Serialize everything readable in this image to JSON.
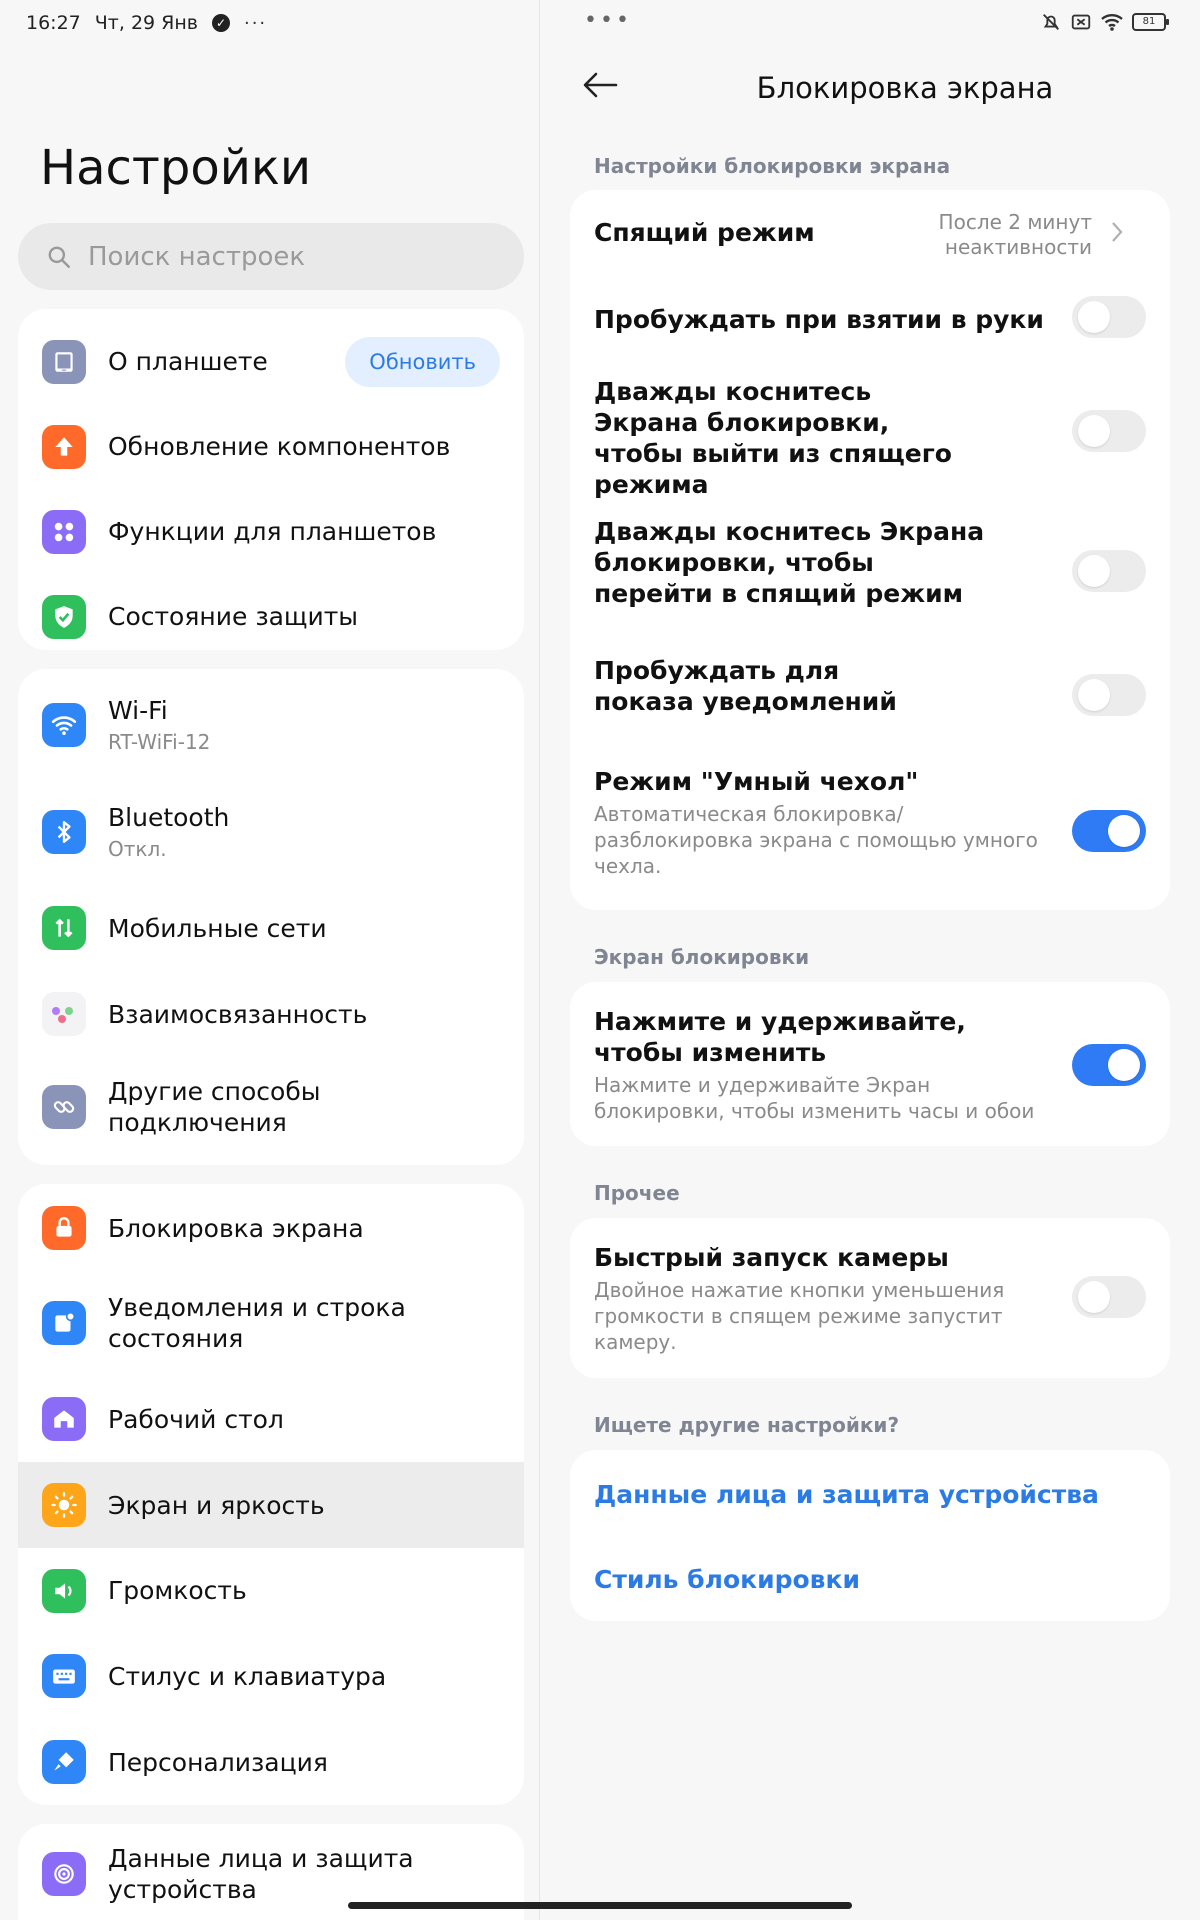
{
  "status_bar": {
    "time": "16:27",
    "date": "Чт, 29 Янв",
    "battery": "81"
  },
  "left": {
    "title": "Настройки",
    "search_placeholder": "Поиск настроек",
    "groups": [
      {
        "items": [
          {
            "label": "О планшете",
            "icon": "tablet-icon",
            "color": "#8a93b8",
            "badge": "Обновить"
          },
          {
            "label": "Обновление компонентов",
            "icon": "arrow-up-icon",
            "color": "#ff6a2a"
          },
          {
            "label": "Функции для планшетов",
            "icon": "grid-icon",
            "color": "#8b6cf6"
          },
          {
            "label": "Состояние защиты",
            "icon": "shield-check-icon",
            "color": "#2fbf5c"
          }
        ]
      },
      {
        "items": [
          {
            "label": "Wi-Fi",
            "sub": "RT-WiFi-12",
            "icon": "wifi-icon",
            "color": "#2f86f6"
          },
          {
            "label": "Bluetooth",
            "sub": "Откл.",
            "icon": "bluetooth-icon",
            "color": "#2f86f6"
          },
          {
            "label": "Мобильные сети",
            "icon": "mobile-data-icon",
            "color": "#2fbf5c"
          },
          {
            "label": "Взаимосвязанность",
            "icon": "interconnect-icon",
            "color": "#ffffff"
          },
          {
            "label": "Другие способы подключения",
            "icon": "link-icon",
            "color": "#8a93b8"
          }
        ]
      },
      {
        "items": [
          {
            "label": "Блокировка экрана",
            "icon": "lock-icon",
            "color": "#ff6a2a"
          },
          {
            "label": "Уведомления и строка состояния",
            "icon": "notification-icon",
            "color": "#2f86f6"
          },
          {
            "label": "Рабочий стол",
            "icon": "home-icon",
            "color": "#8b6cf6"
          },
          {
            "label": "Экран и яркость",
            "icon": "brightness-icon",
            "color": "#ffa51a",
            "active": true
          },
          {
            "label": "Громкость",
            "icon": "volume-icon",
            "color": "#2fbf5c"
          },
          {
            "label": "Стилус и клавиатура",
            "icon": "keyboard-icon",
            "color": "#2f86f6"
          },
          {
            "label": "Персонализация",
            "icon": "brush-icon",
            "color": "#2f86f6"
          }
        ]
      },
      {
        "items": [
          {
            "label": "Данные лица и защита устройства",
            "icon": "fingerprint-icon",
            "color": "#8b6cf6"
          }
        ]
      }
    ]
  },
  "right": {
    "title": "Блокировка экрана",
    "section1": "Настройки блокировки экрана",
    "sleep_title": "Спящий режим",
    "sleep_value": "После 2 минут неактивности",
    "sleep_value_line1": "После 2 минут",
    "sleep_value_line2": "неактивности",
    "toggles1": [
      {
        "title": "Пробуждать при взятии в руки",
        "on": false
      },
      {
        "title": "Дважды коснитесь Экрана блокировки, чтобы выйти из спящего режима",
        "on": false
      },
      {
        "title": "Дважды коснитесь Экрана блокировки, чтобы перейти в спящий режим",
        "on": false
      },
      {
        "title": "Пробуждать для показа уведомлений",
        "on": false
      },
      {
        "title": "Режим \"Умный чехол\"",
        "sub": "Автоматическая блокировка/ разблокировка экрана с помощью умного чехла.",
        "on": true
      }
    ],
    "section2": "Экран блокировки",
    "hold_title": "Нажмите и удерживайте, чтобы изменить",
    "hold_sub": "Нажмите и удерживайте Экран блокировки, чтобы изменить часы и обои",
    "hold_on": true,
    "section3": "Прочее",
    "camera_title": "Быстрый запуск камеры",
    "camera_sub": "Двойное нажатие кнопки уменьшения громкости в спящем режиме запустит камеру.",
    "camera_on": false,
    "section4": "Ищете другие настройки?",
    "link1": "Данные лица и защита устройства",
    "link2": "Стиль блокировки"
  },
  "colors": {
    "accent": "#2f7bf5",
    "link": "#2c7be5",
    "toggle_off": "#ececec"
  }
}
